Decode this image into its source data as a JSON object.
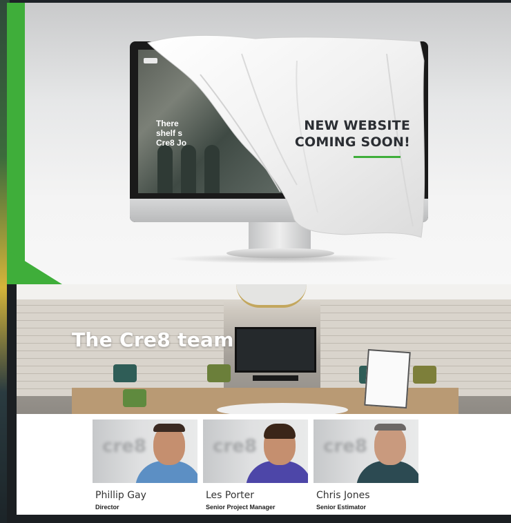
{
  "banner": {
    "headline_line1": "NEW WEBSITE",
    "headline_line2": "COMING SOON!",
    "screen_text_line1": "There",
    "screen_text_line2": "shelf s",
    "screen_text_line3": "Cre8 Jo",
    "accent_color": "#3fae3a"
  },
  "team": {
    "title": "The Cre8 team",
    "photo_logo": "cre8",
    "members": [
      {
        "name": "Phillip Gay",
        "role": "Director"
      },
      {
        "name": "Les Porter",
        "role": "Senior Project Manager"
      },
      {
        "name": "Chris Jones",
        "role": "Senior Estimator"
      }
    ]
  }
}
